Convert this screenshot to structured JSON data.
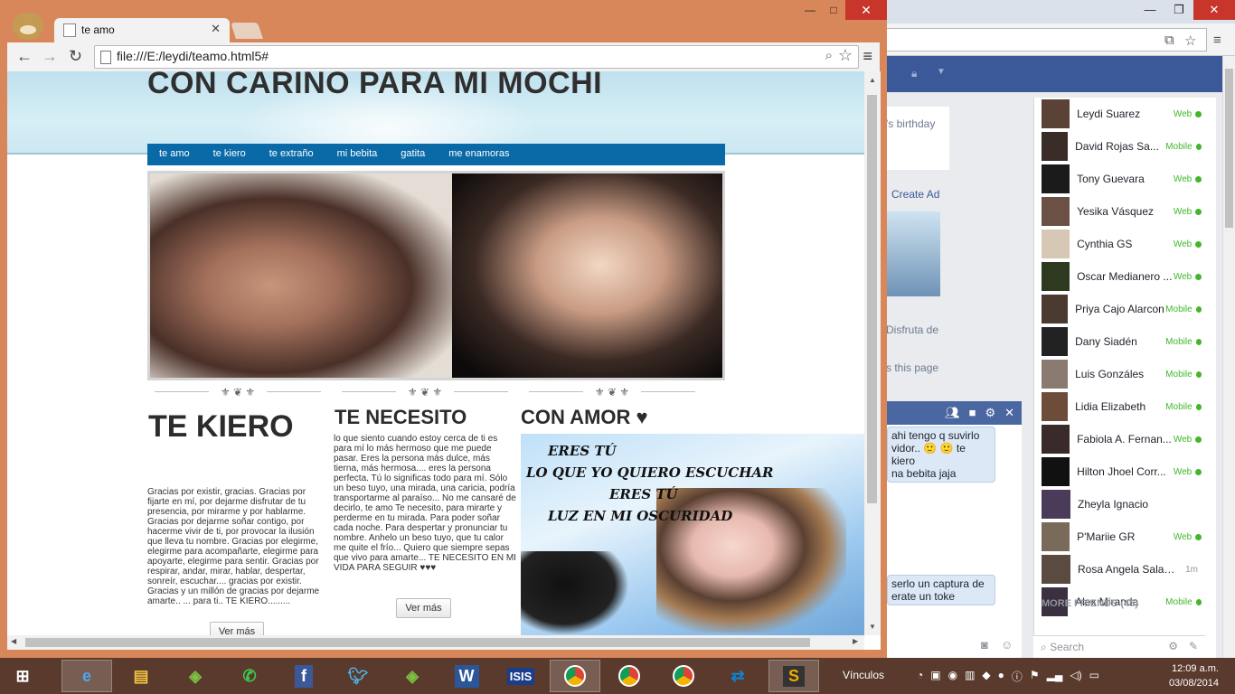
{
  "fb": {
    "feed_texts": {
      "birthday": "'s birthday",
      "create_ad": "Create Ad",
      "disfruta": "Disfruta de",
      "this_page": "s this page"
    },
    "chat_lines": [
      "ahi tengo q suvirlo",
      "vidor.. 🙂 🙂 te kiero",
      "na bebita jaja"
    ],
    "chat_lines2": [
      "serlo un captura de",
      "erate un toke"
    ],
    "buddies": [
      {
        "name": "Leydi Suarez",
        "status": "Web"
      },
      {
        "name": "David Rojas Sa...",
        "status": "Mobile"
      },
      {
        "name": "Tony Guevara",
        "status": "Web"
      },
      {
        "name": "Yesika Vásquez",
        "status": "Web"
      },
      {
        "name": "Cynthia GS",
        "status": "Web"
      },
      {
        "name": "Oscar Medianero ...",
        "status": "Web"
      },
      {
        "name": "Priya Cajo Alarcon",
        "status": "Mobile"
      },
      {
        "name": "Dany Siadén",
        "status": "Mobile"
      },
      {
        "name": "Luis Gonzáles",
        "status": "Mobile"
      },
      {
        "name": "Lidia Elizabeth",
        "status": "Mobile"
      },
      {
        "name": "Fabiola A. Fernan...",
        "status": "Web"
      },
      {
        "name": "Hilton Jhoel Corr...",
        "status": "Web"
      },
      {
        "name": "Zheyla Ignacio",
        "status": ""
      },
      {
        "name": "P'Mariie GR",
        "status": "Web"
      },
      {
        "name": "Rosa Angela Salaza...",
        "status": "1m"
      },
      {
        "name": "Alex Miranda",
        "status": "Mobile"
      }
    ],
    "more_friends": "MORE FRIENDS (45)",
    "search_placeholder": "Search"
  },
  "browser": {
    "tab_title": "te amo",
    "url": "file:///E:/leydi/teamo.html5#"
  },
  "page": {
    "title": "CON CARINO PARA MI MOCHI",
    "nav": [
      "te amo",
      "te kiero",
      "te extraño",
      "mi bebita",
      "gatita",
      "me enamoras"
    ],
    "col1": {
      "heading": "TE KIERO",
      "text": "Gracias por existir, gracias. Gracias por fijarte en mí, por dejarme disfrutar de tu presencia, por mirarme y por hablarme. Gracias por dejarme soñar contigo, por hacerme vivir de ti, por provocar la ilusión que lleva tu nombre. Gracias por elegirme, elegirme para acompañarte, elegirme para apoyarte, elegirme para sentir. Gracias por respirar, andar, mirar, hablar, despertar, sonreír, escuchar.... gracias por existir. Gracias y un millón de gracias por dejarme amarte.. ... para ti.. TE KIERO.........",
      "button": "Ver más"
    },
    "col2": {
      "heading": "TE NECESITO",
      "text": "lo que siento cuando estoy cerca de ti es para mí lo más hermoso que me puede pasar. Eres la persona más dulce, más tierna, más hermosa.... eres la persona perfecta. Tú lo significas todo para mí. Sólo un beso tuyo, una mirada, una caricia, podría transportarme al paraíso... No me cansaré de decirlo, te amo Te necesito, para mirarte y perderme en tu mirada. Para poder soñar cada noche. Para despertar y pronunciar tu nombre. Anhelo un beso tuyo, que tu calor me quite el frío... Quiero que siempre sepas que vivo para amarte... TE NECESITO EN MI VIDA PARA SEGUIR ♥♥♥",
      "button": "Ver más"
    },
    "col3": {
      "heading": "CON AMOR ♥",
      "image_lines": [
        "ERES TÚ",
        "LO QUE YO QUIERO ESCUCHAR",
        "ERES TÚ",
        "LUZ EN MI OSCURIDAD"
      ]
    }
  },
  "taskbar": {
    "links_label": "Vínculos",
    "time": "12:09 a.m.",
    "date": "03/08/2014"
  }
}
